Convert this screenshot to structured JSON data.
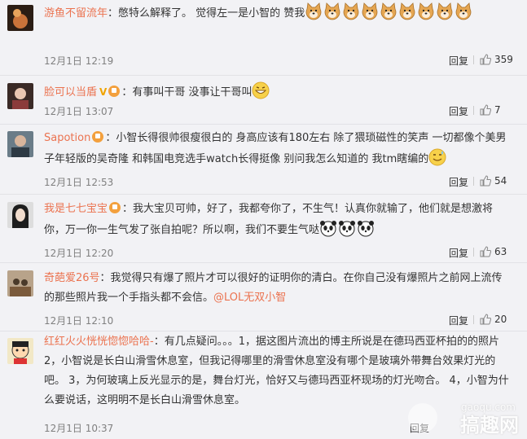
{
  "comments": [
    {
      "username": "游鱼不留流年",
      "text": "：憋特么解释了。 觉得左一是小智的 赞我",
      "time": "12月1日 12:19",
      "reply": "回复",
      "likes": "359",
      "emoji_count": 9
    },
    {
      "username": "脸可以当盾",
      "text": "：有事叫干哥 没事让干哥叫",
      "time": "12月1日 13:07",
      "reply": "回复",
      "likes": "7"
    },
    {
      "username": "Sapotion",
      "text": "：小智长得很帅很瘦很白的 身高应该有180左右 除了猥琐磁性的笑声 一切都像个美男子年轻版的吴奇隆 和韩国电竞选手watch长得挺像 别问我怎么知道的 我tm瞎编的",
      "time": "12月1日 12:53",
      "reply": "回复",
      "likes": "54"
    },
    {
      "username": "我是七七宝宝",
      "text": "：我大宝贝可帅，好了，我都夸你了，不生气！认真你就输了，他们就是想激将你，万一你一生气发了张自拍呢？所以啊，我们不要生气哒",
      "time": "12月1日 12:20",
      "reply": "回复",
      "likes": "63"
    },
    {
      "username": "奇葩爱26号",
      "text": "：我觉得只有爆了照片才可以很好的证明你的清白。在你自己没有爆照片之前网上流传的那些照片我一个手指头都不会信。",
      "mention": "@LOL无双小智",
      "time": "12月1日 12:10",
      "reply": "回复",
      "likes": "20"
    },
    {
      "username": "红红火火恍恍惚惚哈哈-",
      "text": "：有几点疑问。。。1，据这图片流出的博主所说是在德玛西亚杯拍的的照片2，小智说是长白山滑雪休息室，但我记得哪里的滑雪休息室没有哪个是玻璃外带舞台效果灯光的吧。 3，为何玻璃上反光显示的是，舞台灯光，恰好又与德玛西亚杯现场的灯光吻合。 4，小智为什么要说话，这明明不是长白山滑雪休息室。",
      "time": "12月1日 10:37",
      "reply": "回复"
    }
  ],
  "watermark": {
    "line1": "gaoqu.com",
    "line2": "搞趣网"
  },
  "colors": {
    "username": "#eb7350",
    "background": "#f2f2f5",
    "meta": "#808080"
  }
}
